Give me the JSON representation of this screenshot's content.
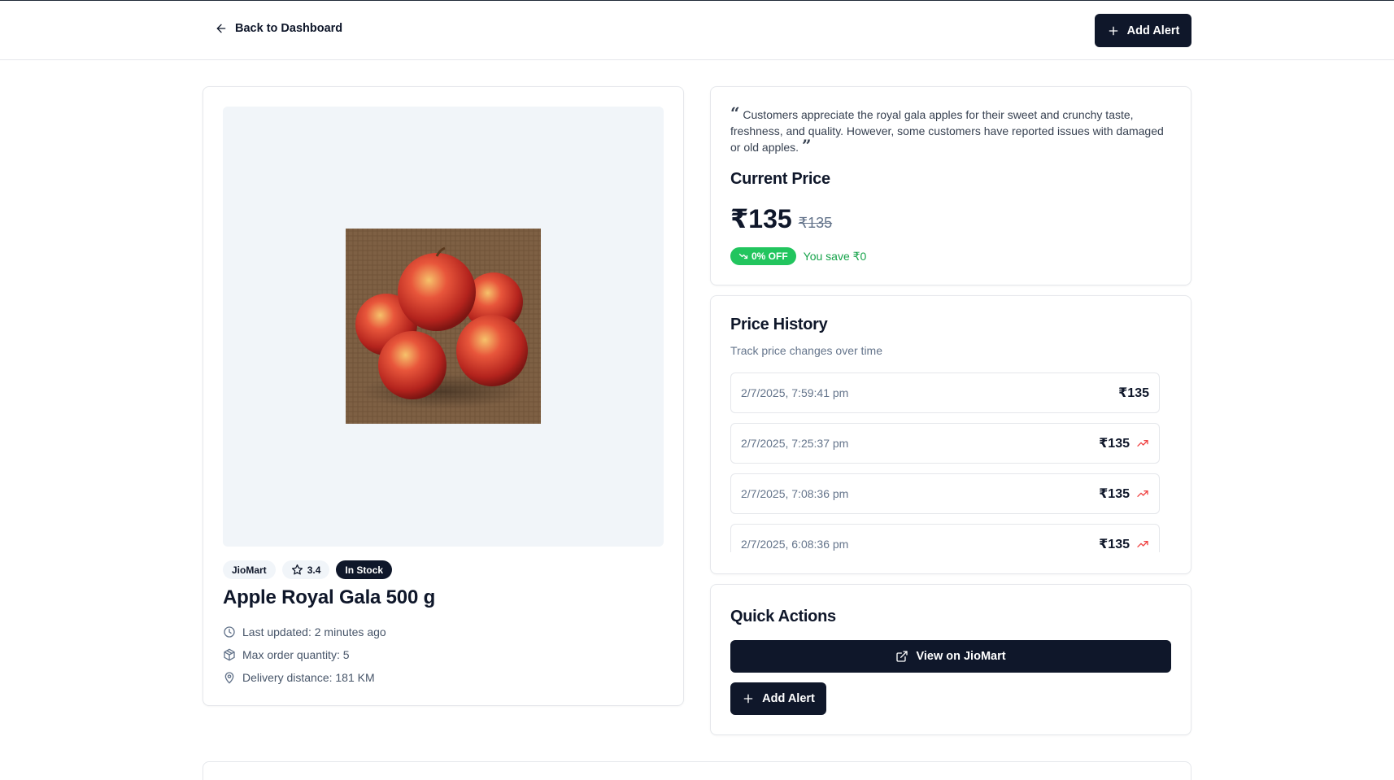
{
  "header": {
    "back_label": "Back to Dashboard",
    "add_alert_label": "Add Alert"
  },
  "product": {
    "image_subject": "red-apples-photo",
    "badges": {
      "store": "JioMart",
      "rating": "3.4",
      "stock": "In Stock"
    },
    "title": "Apple Royal Gala 500 g",
    "meta": {
      "last_updated": "Last updated: 2 minutes ago",
      "max_order": "Max order quantity: 5",
      "delivery": "Delivery distance: 181 KM"
    }
  },
  "price": {
    "review_text": "Customers appreciate the royal gala apples for their sweet and crunchy taste, freshness, and quality. However, some customers have reported issues with damaged or old apples.",
    "title": "Current Price",
    "current": "₹135",
    "original": "₹135",
    "discount": "0% OFF",
    "savings": "You save ₹0"
  },
  "history": {
    "title": "Price History",
    "subtitle": "Track price changes over time",
    "entries": [
      {
        "date": "2/7/2025, 7:59:41 pm",
        "price": "₹135",
        "trend": "none"
      },
      {
        "date": "2/7/2025, 7:25:37 pm",
        "price": "₹135",
        "trend": "trending-up-icon"
      },
      {
        "date": "2/7/2025, 7:08:36 pm",
        "price": "₹135",
        "trend": "trending-up-icon"
      },
      {
        "date": "2/7/2025, 6:08:36 pm",
        "price": "₹135",
        "trend": "trending-up-icon"
      }
    ]
  },
  "quick_actions": {
    "title": "Quick Actions",
    "view_label": "View on JioMart",
    "add_alert_label": "Add Alert"
  },
  "colors": {
    "primary": "#0f172a",
    "discount_green": "#22c55e",
    "savings_text": "#16a34a",
    "trend_red": "#ef4444"
  }
}
